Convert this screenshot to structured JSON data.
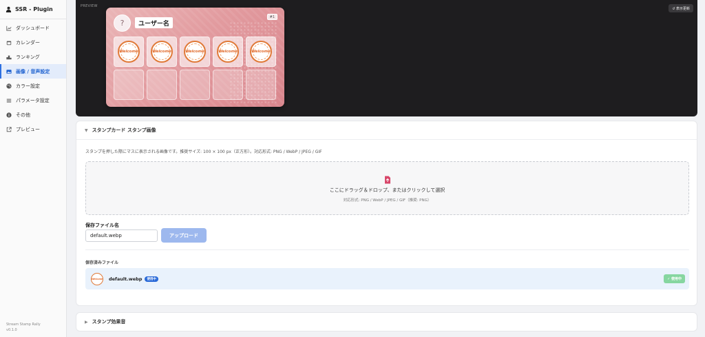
{
  "app": {
    "title": "SSR - Plugin",
    "footer_name": "Stream Stamp Rally",
    "footer_version": "v0.1.0"
  },
  "sidebar": {
    "items": [
      {
        "label": "ダッシュボード",
        "icon": "chart-line-icon"
      },
      {
        "label": "カレンダー",
        "icon": "calendar-icon"
      },
      {
        "label": "ランキング",
        "icon": "ranking-icon"
      },
      {
        "label": "画像 / 音声設定",
        "icon": "image-icon",
        "active": true
      },
      {
        "label": "カラー設定",
        "icon": "palette-icon"
      },
      {
        "label": "パラメータ設定",
        "icon": "sliders-icon"
      },
      {
        "label": "その他",
        "icon": "info-icon"
      },
      {
        "label": "プレビュー",
        "icon": "external-link-icon"
      }
    ]
  },
  "preview": {
    "label": "PREVIEW",
    "refresh_label": "↺ 表示更新",
    "card": {
      "avatar_glyph": "?",
      "username": "ユーザー名",
      "number": "#1",
      "stamp_text": "Welcome",
      "filled_slots": 5,
      "total_slots": 10
    }
  },
  "stamp_section": {
    "title": "スタンプカード スタンプ画像",
    "description": "スタンプを押した際にマスに表示される画像です。推奨サイズ: 100 × 100 px（正方形）。対応形式: PNG / WebP / JPEG / GIF",
    "dropzone_text": "ここにドラッグ＆ドロップ、またはクリックして選択",
    "dropzone_sub": "対応形式: PNG / WebP / JPEG / GIF（推奨: PNG）",
    "filename_label": "保存ファイル名",
    "filename_value": "default.webp",
    "upload_label": "アップロード",
    "saved_label": "保存済みファイル",
    "saved_files": [
      {
        "name": "default.webp",
        "badge": "使用中",
        "action": "✓ 使用中"
      }
    ]
  },
  "effect_section": {
    "title": "スタンプ効果音"
  },
  "colors": {
    "accent": "#2d6fe0",
    "card_pink": "#e29b9f",
    "preview_bg": "#1e1d1f"
  }
}
